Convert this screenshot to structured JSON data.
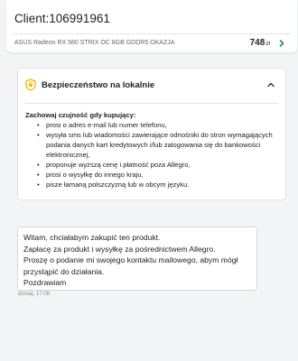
{
  "header": {
    "client_title": "Client:106991961",
    "product_name": "ASUS Radeon RX 580 STRIX OC 8GB GDDR5 OKAZJA",
    "price_value": "748",
    "price_currency": "zł"
  },
  "safety": {
    "title": "Bezpieczeństwo na lokalnie",
    "lead": "Zachowaj czujność gdy kupujący:",
    "items": [
      "prosi o adres e-mail lub numer telefonu,",
      "wysyła sms lub wiadomości zawierające odnośniki do stron wymagających podania danych kart kredytowych i/lub zalogowania się do bankowości elektronicznej,",
      "proponuje wyższą cenę i płatność poza Allegro,",
      "prosi o wysyłkę do innego kraju,",
      "pisze łamaną polszczyzną lub w obcym języku."
    ]
  },
  "message": {
    "lines": [
      "Witam, chciałabym zakupić ten produkt.",
      "Zapłacę za produkt i wysyłkę za pośrednictwem Allegro.",
      "Proszę o podanie mi swojego kontaktu mailowego, abym mógł",
      "przystąpić do działania.",
      "Pozdrawiam"
    ],
    "time": "dzisiaj, 17:08"
  },
  "colors": {
    "accent_green": "#1e8a4c",
    "shield_yellow": "#f5b400"
  }
}
